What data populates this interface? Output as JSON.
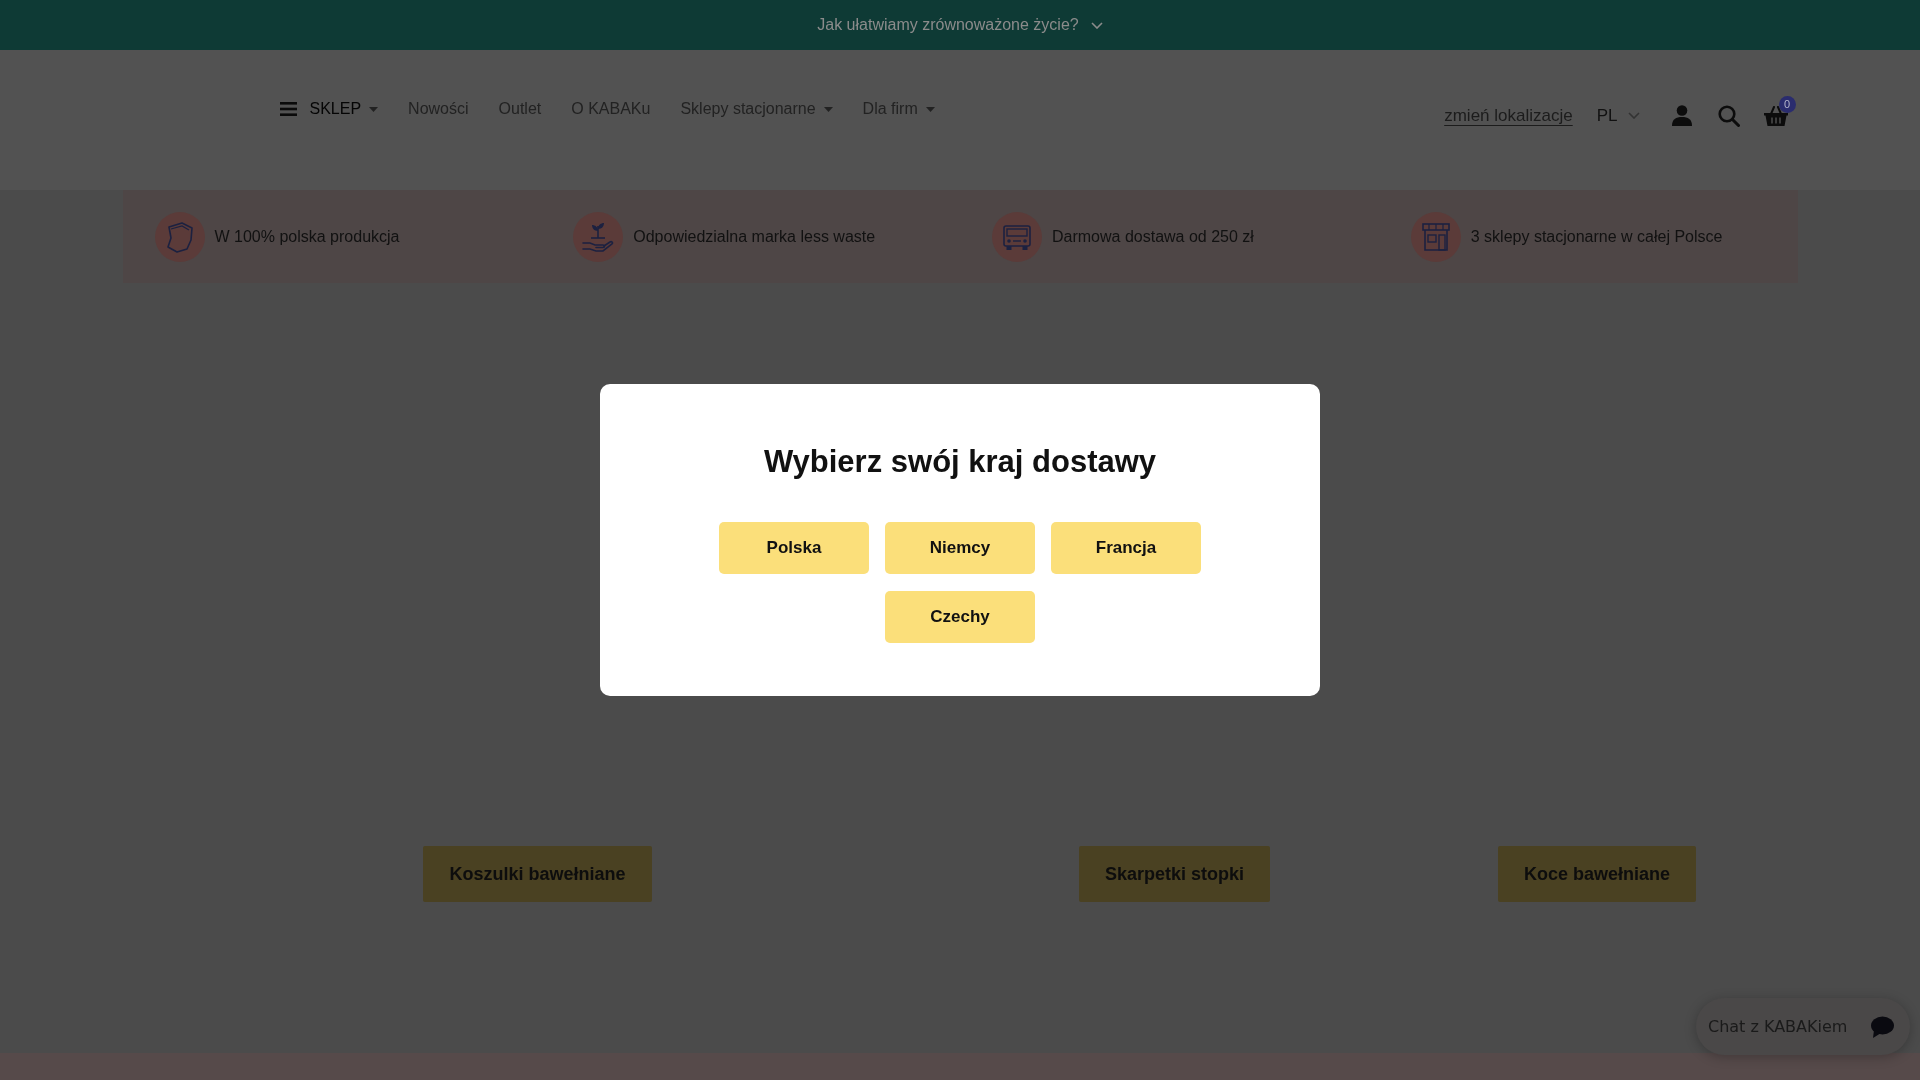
{
  "announcement": {
    "text": "Jak ułatwiamy zrównoważone życie?"
  },
  "header": {
    "nav": [
      {
        "label": "SKLEP",
        "kind": "menu",
        "dropdown": true
      },
      {
        "label": "Nowości",
        "kind": "link",
        "dropdown": false
      },
      {
        "label": "Outlet",
        "kind": "link",
        "dropdown": false
      },
      {
        "label": "O KABAKu",
        "kind": "link",
        "dropdown": false
      },
      {
        "label": "Sklepy stacjonarne",
        "kind": "link",
        "dropdown": true
      },
      {
        "label": "Dla firm",
        "kind": "link",
        "dropdown": true
      }
    ],
    "location_link": "zmień lokalizacje",
    "language": "PL",
    "cart_count": "0"
  },
  "features": [
    "W 100% polska produkcja",
    "Odpowiedzialna marka less waste",
    "Darmowa dostawa od 250 zł",
    "3 sklepy stacjonarne w całej Polsce"
  ],
  "modal": {
    "title": "Wybierz swój kraj dostawy",
    "countries": [
      "Polska",
      "Niemcy",
      "Francja",
      "Czechy"
    ]
  },
  "categories": [
    "Koszulki bawełniane",
    "Skarpetki stopki",
    "Koce bawełniane"
  ],
  "chat_widget": {
    "label": "Chat z KABAKiem"
  }
}
